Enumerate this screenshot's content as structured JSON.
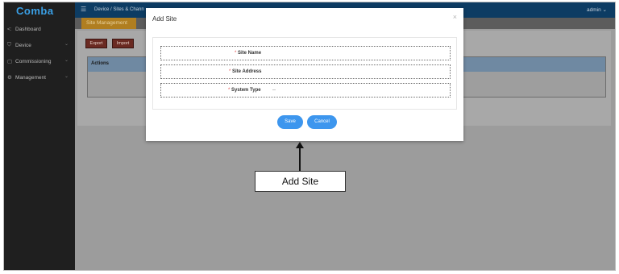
{
  "app": {
    "logo": "Comba",
    "user": "admin"
  },
  "breadcrumb": "Device  /  Sites & Chann",
  "sidebar": {
    "items": [
      {
        "icon": "<:",
        "label": "Dashboard"
      },
      {
        "icon": "⛉",
        "label": "Device"
      },
      {
        "icon": "▢",
        "label": "Commissioning"
      },
      {
        "icon": "⚙",
        "label": "Management"
      }
    ]
  },
  "tabs": {
    "active": "Site Management"
  },
  "toolbar": {
    "export_label": "Export",
    "import_label": "Import"
  },
  "table": {
    "headers": [
      "Actions"
    ]
  },
  "modal": {
    "title": "Add Site",
    "close": "×",
    "fields": [
      {
        "label": "Site Name",
        "required": true,
        "value": ""
      },
      {
        "label": "Site Address",
        "required": true,
        "value": ""
      },
      {
        "label": "System Type",
        "required": true,
        "value": "--"
      }
    ],
    "save_label": "Save",
    "cancel_label": "Cancel"
  },
  "annotation": {
    "label": "Add Site"
  },
  "colors": {
    "accent": "#3d96ee",
    "topbar": "#0d3c63",
    "sidebar": "#1f1f1f",
    "tab_active": "#b07e20"
  }
}
